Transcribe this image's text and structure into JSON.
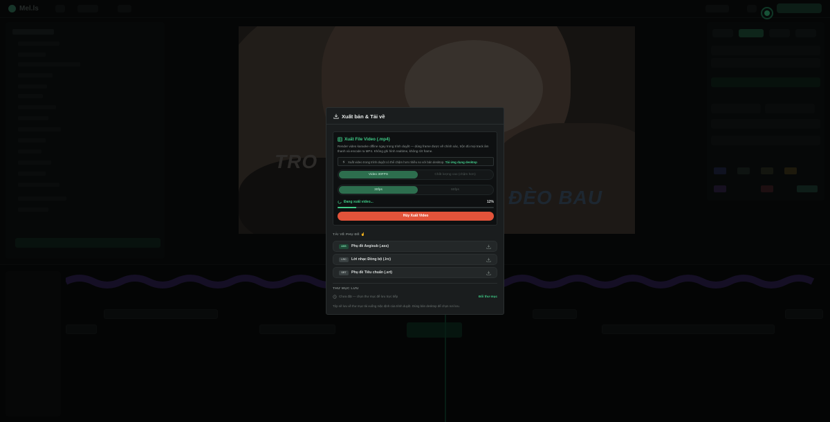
{
  "app": {
    "logo_text": "Mel.ls"
  },
  "preview": {
    "lyric_left": "TRO",
    "lyric_right": "ĐÈO BAU"
  },
  "modal": {
    "title": "Xuất bản & Tải về",
    "export_card": {
      "title": "Xuất File Video (.mp4)",
      "description": "Render video karaoke offline ngay trong trình duyệt — dùng frame được vẽ chính xác, trộn đủ mọi track âm thanh và encode ra MP4. Không ghi hình realtime, không rớt frame.",
      "notice_text": "Xuất video trong trình duyệt có thể chậm hơn nhiều so với bản desktop.",
      "notice_link": "Tải ứng dụng desktop",
      "quality_options": [
        "Video 30FPS",
        "Chất lượng cao (chậm hơn)"
      ],
      "quality_selected": 0,
      "fps_options": [
        "30fps",
        "60fps"
      ],
      "fps_selected": 0,
      "progress_label": "Đang xuất video...",
      "progress_percent_text": "12%",
      "progress_fraction": 0.12,
      "cancel_label": "Hủy Xuất Video"
    },
    "subtitles": {
      "section_label": "TẢI VỀ PHỤ ĐỀ",
      "items": [
        {
          "badge": "ASS",
          "label": "Phụ đề Aegisub (.ass)"
        },
        {
          "badge": "LRC",
          "label": "Lời nhạc Đồng bộ (.lrc)"
        },
        {
          "badge": "SRT",
          "label": "Phụ đề Tiêu chuẩn (.srt)"
        }
      ]
    },
    "folder": {
      "section_label": "THƯ MỤC LƯU",
      "current": "Chưa đặt — chọn thư mục để lưu trực tiếp",
      "change_label": "Đổi thư mục",
      "footnote": "Tệp sẽ lưu về thư mục tải xuống mặc định của trình duyệt. Dùng bản desktop để chọn nơi lưu."
    }
  },
  "colors": {
    "accent": "#3fcb87",
    "danger": "#e2533a",
    "modal_bg": "#1a1d1e",
    "card_bg": "#0e1011"
  }
}
